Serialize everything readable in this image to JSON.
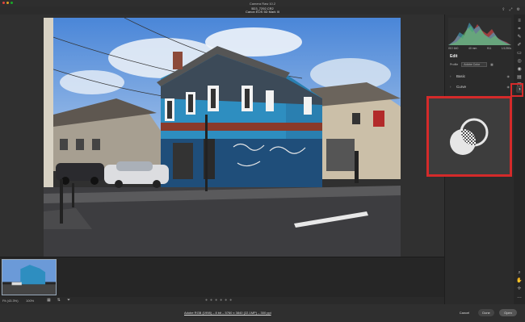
{
  "window": {
    "title": "Camera Raw 10.2",
    "filename": "5D3_7292.CR2",
    "camera": "Canon EOS 5D Mark III"
  },
  "panel": {
    "exif": [
      "ISO 640",
      "40 mm",
      "f/11",
      "1/1250s"
    ],
    "edit_label": "Edit",
    "profile_label": "Profile",
    "profile_value": "Adobe Color",
    "sections": [
      {
        "label": "Basic"
      },
      {
        "label": "Curve"
      }
    ]
  },
  "tools": [
    {
      "name": "histogram-icon",
      "glyph": "≡"
    },
    {
      "name": "crop-icon",
      "glyph": "⌗"
    },
    {
      "name": "healing-icon",
      "glyph": "✎"
    },
    {
      "name": "brush-icon",
      "glyph": "✐"
    },
    {
      "name": "graduated-filter-icon",
      "glyph": "▭"
    },
    {
      "name": "radial-filter-icon",
      "glyph": "◎"
    },
    {
      "name": "redeye-icon",
      "glyph": "◉"
    },
    {
      "name": "presets-icon",
      "glyph": "▤"
    },
    {
      "name": "snapshots-icon",
      "glyph": "❐"
    },
    {
      "name": "masking-icon",
      "glyph": "◑"
    }
  ],
  "bottom_tools": [
    {
      "name": "zoom-tool-icon",
      "glyph": "⌕"
    },
    {
      "name": "hand-tool-icon",
      "glyph": "✋"
    },
    {
      "name": "sampler-icon",
      "glyph": "✛"
    },
    {
      "name": "more-tools-icon",
      "glyph": "…"
    }
  ],
  "view": {
    "zoom_label": "Fit (43.3%)",
    "zoom_value": "100%"
  },
  "footer": {
    "info": "Adobe RGB (1998) – 8 bit – 5760 x 3840 (22.1MP) – 300 ppi",
    "cancel": "Cancel",
    "done": "Done",
    "open": "Open"
  },
  "colors": {
    "highlight": "#d42a2a",
    "panel_bg": "#2b2b2b"
  }
}
